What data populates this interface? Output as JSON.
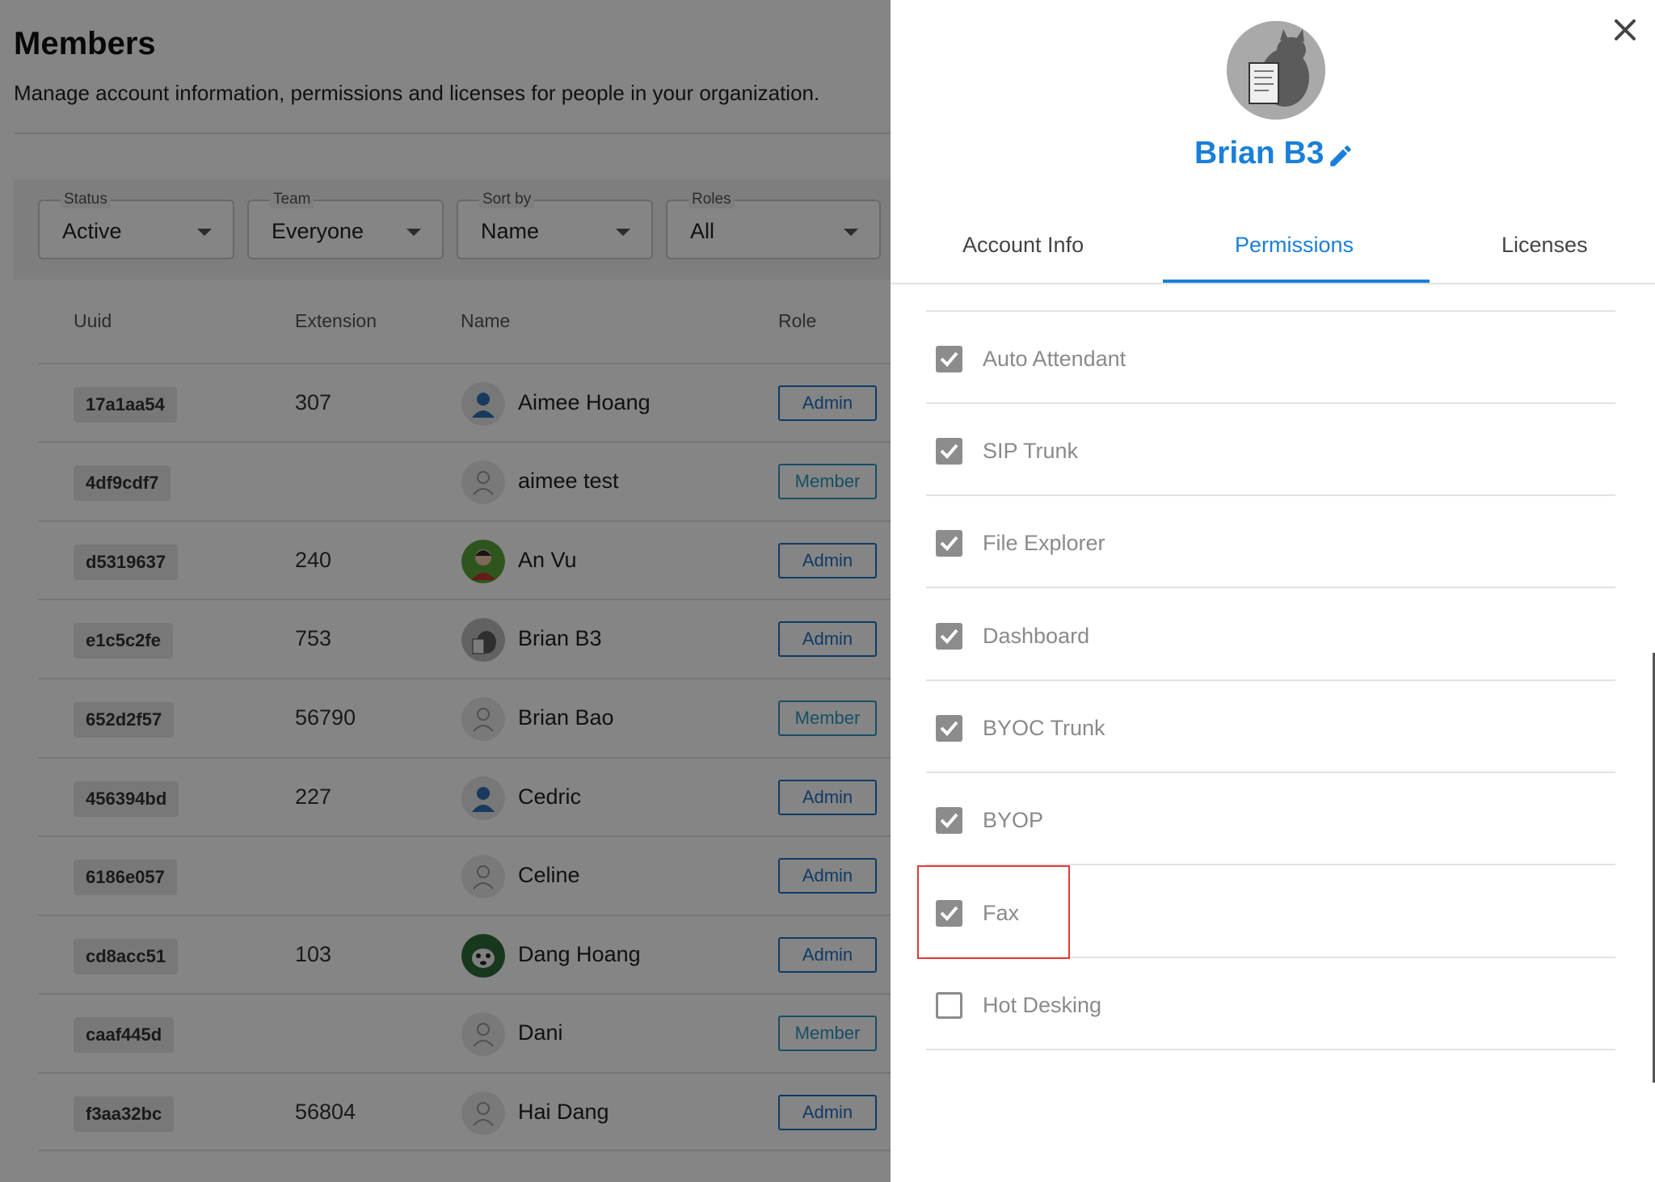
{
  "page": {
    "title": "Members",
    "subtitle": "Manage account information, permissions and licenses for people in your organization."
  },
  "filters": {
    "status": {
      "label": "Status",
      "value": "Active"
    },
    "team": {
      "label": "Team",
      "value": "Everyone"
    },
    "sort": {
      "label": "Sort by",
      "value": "Name"
    },
    "roles": {
      "label": "Roles",
      "value": "All"
    }
  },
  "table": {
    "headers": {
      "uuid": "Uuid",
      "extension": "Extension",
      "name": "Name",
      "role": "Role"
    },
    "rows": [
      {
        "uuid": "17a1aa54",
        "ext": "307",
        "name": "Aimee Hoang",
        "role": "Admin",
        "avatar": "person-blue-icon"
      },
      {
        "uuid": "4df9cdf7",
        "ext": "",
        "name": "aimee test",
        "role": "Member",
        "avatar": "person-outline-icon"
      },
      {
        "uuid": "d5319637",
        "ext": "240",
        "name": "An Vu",
        "role": "Admin",
        "avatar": "photo"
      },
      {
        "uuid": "e1c5c2fe",
        "ext": "753",
        "name": "Brian B3",
        "role": "Admin",
        "avatar": "photo"
      },
      {
        "uuid": "652d2f57",
        "ext": "56790",
        "name": "Brian Bao",
        "role": "Member",
        "avatar": "person-outline-icon"
      },
      {
        "uuid": "456394bd",
        "ext": "227",
        "name": "Cedric",
        "role": "Admin",
        "avatar": "person-blue-icon"
      },
      {
        "uuid": "6186e057",
        "ext": "",
        "name": "Celine",
        "role": "Admin",
        "avatar": "person-outline-icon"
      },
      {
        "uuid": "cd8acc51",
        "ext": "103",
        "name": "Dang Hoang",
        "role": "Admin",
        "avatar": "photo"
      },
      {
        "uuid": "caaf445d",
        "ext": "",
        "name": "Dani",
        "role": "Member",
        "avatar": "person-outline-icon"
      },
      {
        "uuid": "f3aa32bc",
        "ext": "56804",
        "name": "Hai Dang",
        "role": "Admin",
        "avatar": "person-outline-icon"
      }
    ]
  },
  "drawer": {
    "name": "Brian B3",
    "tabs": [
      {
        "label": "Account Info",
        "active": false
      },
      {
        "label": "Permissions",
        "active": true
      },
      {
        "label": "Licenses",
        "active": false
      }
    ],
    "permissions": [
      {
        "label": "Auto Attendant",
        "checked": true
      },
      {
        "label": "SIP Trunk",
        "checked": true
      },
      {
        "label": "File Explorer",
        "checked": true
      },
      {
        "label": "Dashboard",
        "checked": true
      },
      {
        "label": "BYOC Trunk",
        "checked": true
      },
      {
        "label": "BYOP",
        "checked": true
      },
      {
        "label": "Fax",
        "checked": true
      },
      {
        "label": "Hot Desking",
        "checked": false
      }
    ]
  },
  "colors": {
    "accent": "#1a7fd8",
    "admin_badge": "#1f6fc4",
    "member_badge": "#2d97c2",
    "checkbox": "#8c8c8c",
    "highlight": "#e53935"
  }
}
